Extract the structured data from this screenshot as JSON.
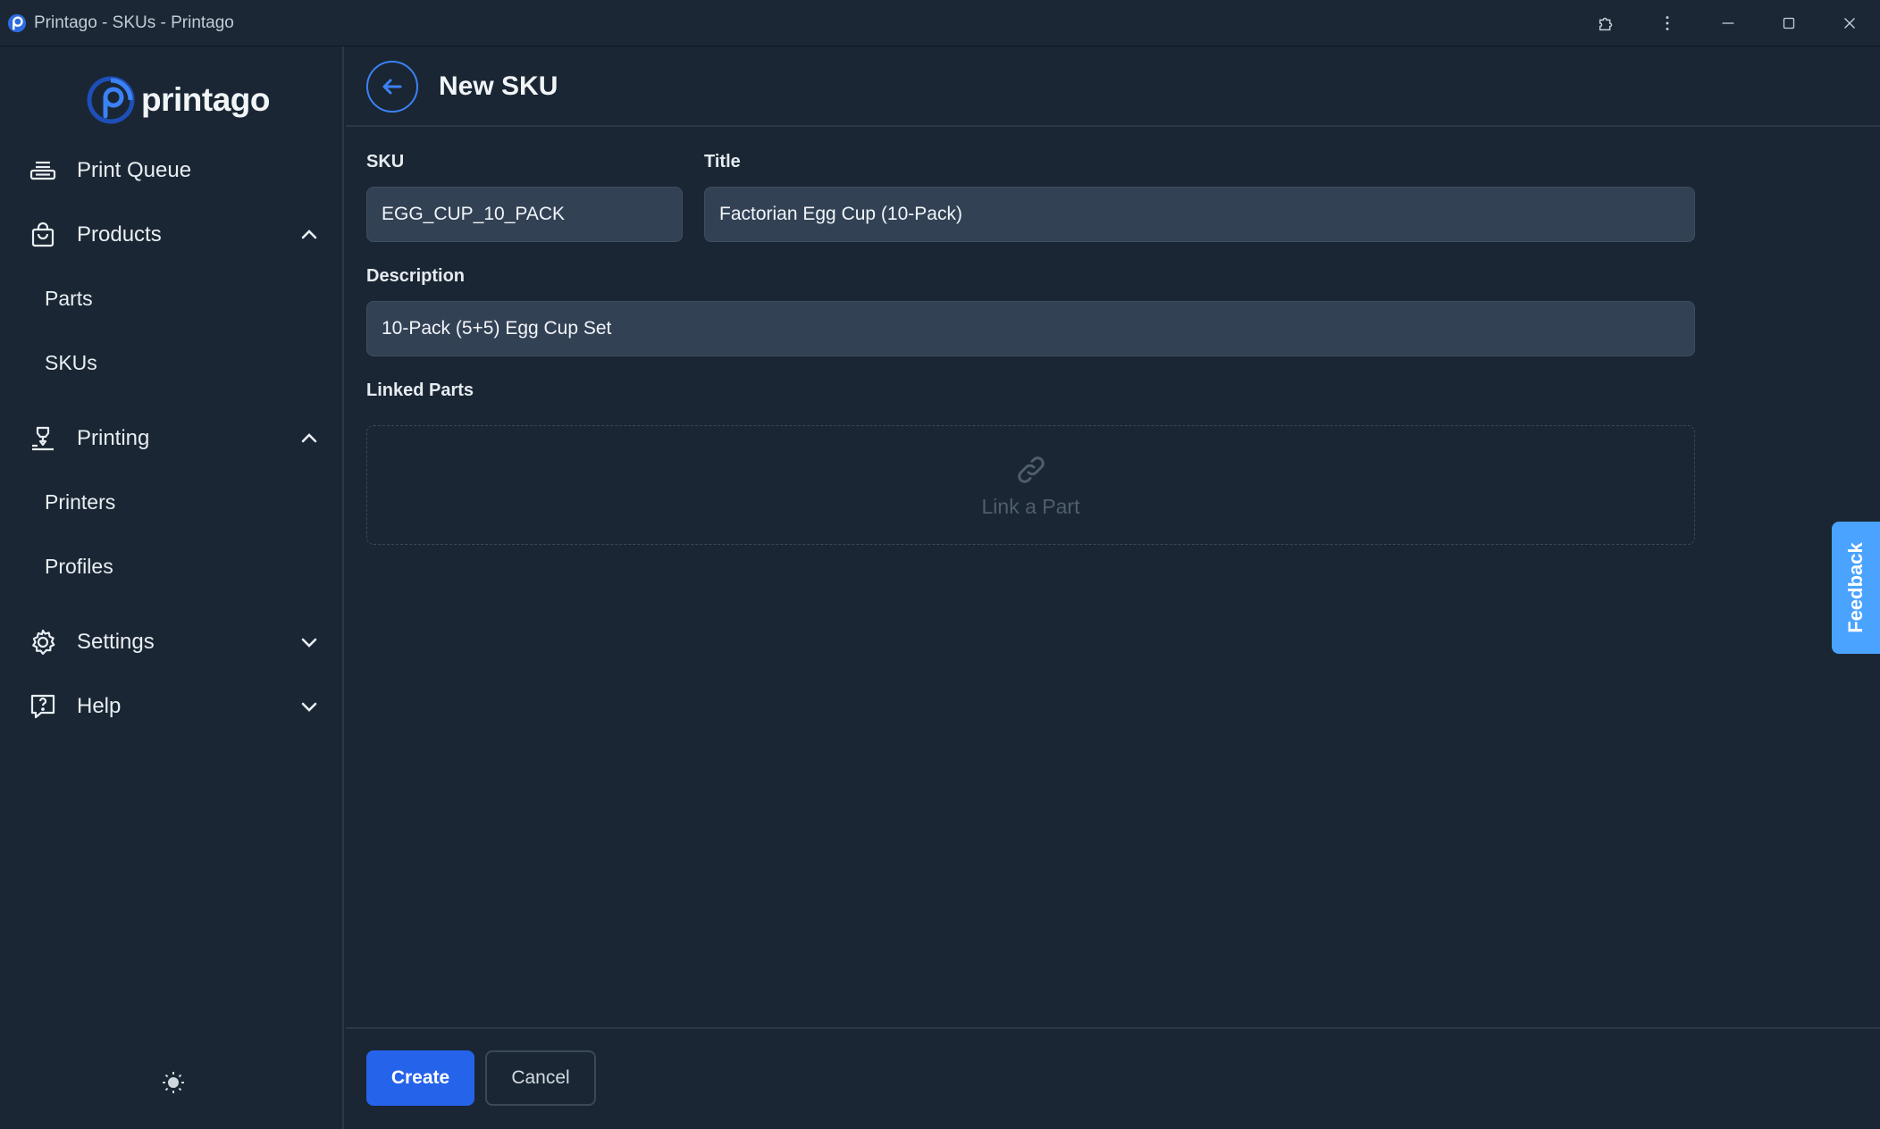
{
  "window": {
    "title": "Printago - SKUs - Printago"
  },
  "brand": {
    "name": "printago"
  },
  "sidebar": {
    "items": [
      {
        "label": "Print Queue",
        "icon": "print-queue-icon"
      },
      {
        "label": "Products",
        "icon": "shopping-bag-icon",
        "expanded": true,
        "children": [
          "Parts",
          "SKUs"
        ]
      },
      {
        "label": "Printing",
        "icon": "printer-nozzle-icon",
        "expanded": true,
        "children": [
          "Printers",
          "Profiles"
        ]
      },
      {
        "label": "Settings",
        "icon": "gear-icon",
        "expanded": false
      },
      {
        "label": "Help",
        "icon": "help-icon",
        "expanded": false
      }
    ],
    "theme_icon": "sun-icon"
  },
  "page": {
    "title": "New SKU",
    "fields": {
      "sku": {
        "label": "SKU",
        "value": "EGG_CUP_10_PACK"
      },
      "title": {
        "label": "Title",
        "value": "Factorian Egg Cup (10-Pack)"
      },
      "description": {
        "label": "Description",
        "value": "10-Pack (5+5) Egg Cup Set"
      }
    },
    "linked_parts": {
      "label": "Linked Parts",
      "empty_action": "Link a Part"
    }
  },
  "footer": {
    "create_label": "Create",
    "cancel_label": "Cancel"
  },
  "feedback": {
    "label": "Feedback"
  },
  "colors": {
    "accent": "#2563eb",
    "feedback": "#4aa3ff",
    "background": "#1a2633",
    "input_bg": "#334155"
  }
}
